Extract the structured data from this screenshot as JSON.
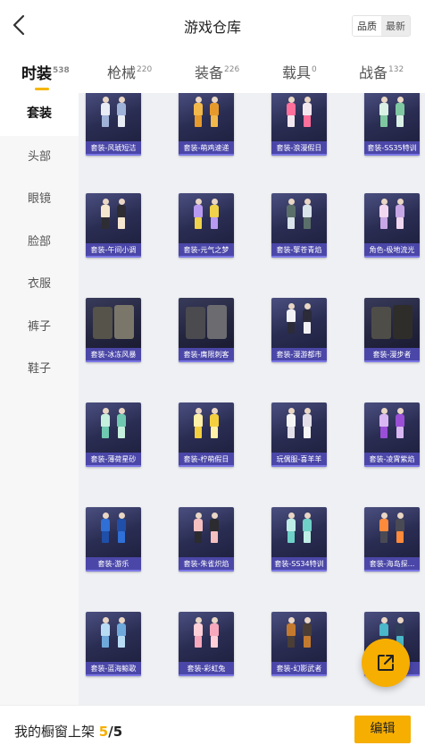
{
  "header": {
    "title": "游戏仓库",
    "sort_options": [
      "品质",
      "最新"
    ],
    "selected_sort": "最新"
  },
  "tabs": [
    {
      "label": "时装",
      "count": "538"
    },
    {
      "label": "枪械",
      "count": "220"
    },
    {
      "label": "装备",
      "count": "226"
    },
    {
      "label": "载具",
      "count": "0"
    },
    {
      "label": "战备",
      "count": "132"
    }
  ],
  "active_tab": "时装",
  "sidebar": {
    "items": [
      "套装",
      "头部",
      "眼镜",
      "脸部",
      "衣服",
      "裤子",
      "鞋子"
    ],
    "active": "套装"
  },
  "items": [
    {
      "label": "套装-风琥短洁",
      "colors": [
        "#e8ecf4",
        "#9fb3d8"
      ]
    },
    {
      "label": "套装-萌鸡速递",
      "colors": [
        "#f2b84a",
        "#e79a2c"
      ]
    },
    {
      "label": "套装-浪漫假日",
      "colors": [
        "#ff6f9c",
        "#f2e7ee"
      ]
    },
    {
      "label": "套装-SS35特训",
      "colors": [
        "#d9f0e4",
        "#7ec7a0"
      ]
    },
    {
      "label": "套装-午间小调",
      "colors": [
        "#f4e6cf",
        "#2d2d33"
      ]
    },
    {
      "label": "套装-元气之梦",
      "colors": [
        "#b89bf0",
        "#f0d34a"
      ]
    },
    {
      "label": "套装-擎苍青焰",
      "colors": [
        "#5b6f6a",
        "#d8e3ea"
      ]
    },
    {
      "label": "角色-极地流光",
      "colors": [
        "#f1d7ef",
        "#c8a7e6"
      ]
    },
    {
      "label": "套装-冰冻风暴",
      "colors": [
        "#55534a",
        "#7a776a"
      ]
    },
    {
      "label": "套装-膺限刺客",
      "colors": [
        "#4a4a4f",
        "#6b6b70"
      ]
    },
    {
      "label": "套装-漫游都市",
      "colors": [
        "#f1f1f5",
        "#2b2b3a"
      ]
    },
    {
      "label": "套装-漫步者",
      "colors": [
        "#4f4d48",
        "#2e2d2a"
      ]
    },
    {
      "label": "套装-薄荷星砂",
      "colors": [
        "#c6f0de",
        "#6fc9b0"
      ]
    },
    {
      "label": "套装-柠萌假日",
      "colors": [
        "#fff1a8",
        "#f4d03f"
      ]
    },
    {
      "label": "玩偶服-喜羊羊",
      "colors": [
        "#f5f5f5",
        "#e2dfe8"
      ]
    },
    {
      "label": "套装-凌霄紫焰",
      "colors": [
        "#d9b7f2",
        "#9a4fd6"
      ]
    },
    {
      "label": "套装-游乐",
      "colors": [
        "#2f6fd6",
        "#1f4fa8"
      ]
    },
    {
      "label": "套装-朱雀炽焰",
      "colors": [
        "#f5c0c0",
        "#2b2b30"
      ]
    },
    {
      "label": "套装-SS34特训",
      "colors": [
        "#bfeee7",
        "#6fd1c7"
      ]
    },
    {
      "label": "套装-海岛探...",
      "colors": [
        "#ff8a3a",
        "#4a4a55"
      ]
    },
    {
      "label": "套装-蓝海鲸歌",
      "colors": [
        "#b9dcf5",
        "#6fa9dc"
      ]
    },
    {
      "label": "套装-彩虹兔",
      "colors": [
        "#ffd0d8",
        "#f7a8bc"
      ]
    },
    {
      "label": "套装-幻影武者",
      "colors": [
        "#c47a2e",
        "#4a3e36"
      ]
    },
    {
      "label": "套装-...",
      "colors": [
        "#4ab8c8",
        "#2f3c5a"
      ]
    }
  ],
  "footer": {
    "showcase_label": "我的橱窗上架",
    "showcase_current": "5",
    "showcase_separator": "/",
    "showcase_total": "5",
    "edit_label": "编辑"
  },
  "icons": {
    "back": "chevron-left-icon",
    "fab": "share-external-icon"
  },
  "accent_color": "#f6ae00",
  "card_label_color": "#4b47a8"
}
